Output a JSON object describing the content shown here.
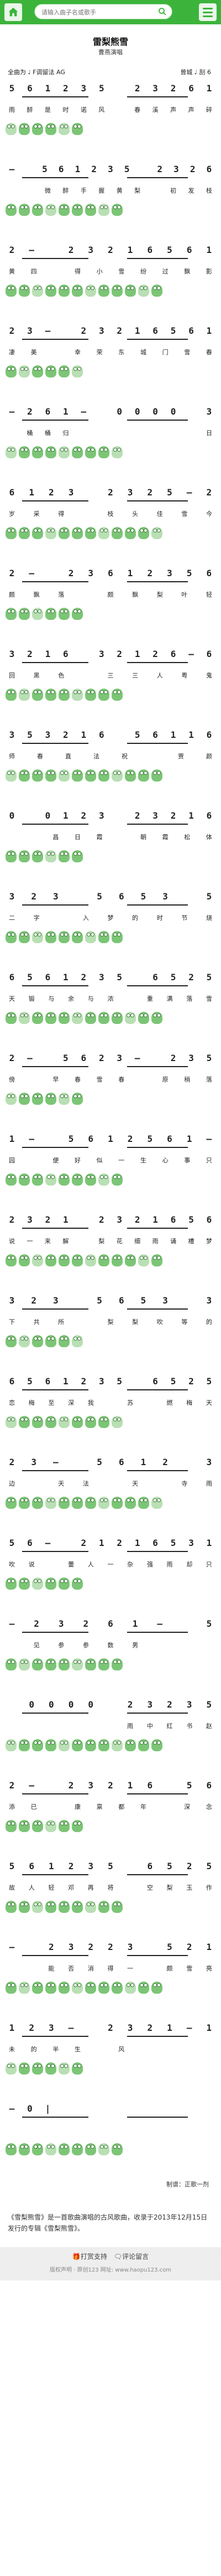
{
  "header": {
    "search_placeholder": "请输入曲子名或歌手",
    "home_icon": "home-icon",
    "menu_icon": "menu-icon"
  },
  "song": {
    "title": "雷梨熊雪",
    "subtitle": "曹燕演唱",
    "meta_left": "全曲为 ♩ F调留法 AG",
    "meta_right": "曾城 ♩ 刮 6"
  },
  "score": [
    {
      "notes": [
        "5",
        "6",
        "1",
        "2",
        "3",
        "5",
        "",
        "2",
        "3",
        "2",
        "6",
        "1"
      ],
      "lyrics": [
        "雨",
        "醉",
        "是",
        "时",
        "诺",
        "风",
        "",
        "春",
        "溪",
        "声",
        "声",
        "碎"
      ]
    },
    {
      "notes": [
        "—",
        "",
        "5",
        "6",
        "1",
        "2",
        "3",
        "5",
        "",
        "2",
        "3",
        "2",
        "6"
      ],
      "lyrics": [
        "",
        "",
        "微",
        "醉",
        "手",
        "握",
        "黄",
        "梨",
        "",
        "初",
        "发",
        "枝"
      ]
    },
    {
      "notes": [
        "2",
        "—",
        "",
        "2",
        "3",
        "2",
        "1",
        "6",
        "5",
        "6",
        "1"
      ],
      "lyrics": [
        "黄",
        "四",
        "",
        "得",
        "小",
        "雪",
        "纷",
        "过",
        "飘",
        "影"
      ]
    },
    {
      "notes": [
        "2",
        "3",
        "—",
        "",
        "2",
        "3",
        "2",
        "1",
        "6",
        "5",
        "6",
        "1"
      ],
      "lyrics": [
        "凄",
        "美",
        "",
        "幸",
        "荣",
        "东",
        "城",
        "门",
        "雪",
        "春"
      ]
    },
    {
      "notes": [
        "—",
        "2",
        "6",
        "1",
        "—",
        "",
        "0",
        "0",
        "0",
        "0",
        "",
        "3"
      ],
      "lyrics": [
        "",
        "桶",
        "桶",
        "归",
        "",
        "",
        "",
        "",
        "",
        "",
        "",
        "日"
      ]
    },
    {
      "notes": [
        "6",
        "1",
        "2",
        "3",
        "",
        "2",
        "3",
        "2",
        "5",
        "—",
        "2"
      ],
      "lyrics": [
        "岁",
        "采",
        "得",
        "",
        "枝",
        "头",
        "佳",
        "雪",
        "今"
      ]
    },
    {
      "notes": [
        "2",
        "—",
        "",
        "2",
        "3",
        "6",
        "1",
        "2",
        "3",
        "5",
        "6"
      ],
      "lyrics": [
        "颇",
        "飘",
        "落",
        "",
        "颇",
        "飘",
        "梨",
        "叶",
        "轻"
      ]
    },
    {
      "notes": [
        "3",
        "2",
        "1",
        "6",
        "",
        "3",
        "2",
        "1",
        "2",
        "6",
        "—",
        "6"
      ],
      "lyrics": [
        "回",
        "黑",
        "色",
        "",
        "三",
        "三",
        "人",
        "粤",
        "鬼"
      ]
    },
    {
      "notes": [
        "3",
        "5",
        "3",
        "2",
        "1",
        "6",
        "",
        "5",
        "6",
        "1",
        "1",
        "6"
      ],
      "lyrics": [
        "师",
        "春",
        "直",
        "法",
        "祝",
        "",
        "贾",
        "颜"
      ]
    },
    {
      "notes": [
        "0",
        "",
        "0",
        "1",
        "2",
        "3",
        "",
        "2",
        "3",
        "2",
        "1",
        "6"
      ],
      "lyrics": [
        "",
        "",
        "昌",
        "日",
        "霞",
        "",
        "朝",
        "霞",
        "松",
        "体"
      ]
    },
    {
      "notes": [
        "3",
        "2",
        "3",
        "",
        "5",
        "6",
        "5",
        "3",
        "",
        "5"
      ],
      "lyrics": [
        "二",
        "字",
        "",
        "入",
        "梦",
        "的",
        "时",
        "节",
        "烧"
      ]
    },
    {
      "notes": [
        "6",
        "5",
        "6",
        "1",
        "2",
        "3",
        "5",
        "",
        "6",
        "5",
        "2",
        "5"
      ],
      "lyrics": [
        "天",
        "锻",
        "与",
        "余",
        "与",
        "浓",
        "",
        "重",
        "满",
        "落",
        "雪"
      ]
    },
    {
      "notes": [
        "2",
        "—",
        "",
        "5",
        "6",
        "2",
        "3",
        "—",
        "",
        "2",
        "3",
        "5"
      ],
      "lyrics": [
        "傍",
        "",
        "早",
        "春",
        "雪",
        "春",
        "",
        "原",
        "稍",
        "落"
      ]
    },
    {
      "notes": [
        "1",
        "—",
        "",
        "5",
        "6",
        "1",
        "2",
        "5",
        "6",
        "1",
        "—"
      ],
      "lyrics": [
        "园",
        "",
        "便",
        "好",
        "似",
        "一",
        "生",
        "心",
        "事",
        "只"
      ]
    },
    {
      "notes": [
        "2",
        "3",
        "2",
        "1",
        "",
        "2",
        "3",
        "2",
        "1",
        "6",
        "5",
        "6"
      ],
      "lyrics": [
        "说",
        "一",
        "来",
        "解",
        "",
        "梨",
        "花",
        "细",
        "雨",
        "诵",
        "槽",
        "梦"
      ]
    },
    {
      "notes": [
        "3",
        "2",
        "3",
        "",
        "5",
        "6",
        "5",
        "3",
        "",
        "3"
      ],
      "lyrics": [
        "下",
        "共",
        "所",
        "",
        "梨",
        "梨",
        "吹",
        "等",
        "的"
      ]
    },
    {
      "notes": [
        "6",
        "5",
        "6",
        "1",
        "2",
        "3",
        "5",
        "",
        "6",
        "5",
        "2",
        "5"
      ],
      "lyrics": [
        "恋",
        "梅",
        "至",
        "深",
        "我",
        "",
        "苏",
        "",
        "燃",
        "梅",
        "天"
      ]
    },
    {
      "notes": [
        "2",
        "3",
        "—",
        "",
        "5",
        "6",
        "1",
        "2",
        "",
        "3"
      ],
      "lyrics": [
        "边",
        "",
        "天",
        "法",
        "",
        "天",
        "",
        "寺",
        "雨"
      ]
    },
    {
      "notes": [
        "5",
        "6",
        "—",
        "",
        "2",
        "1",
        "2",
        "1",
        "6",
        "5",
        "3",
        "1"
      ],
      "lyrics": [
        "吹",
        "说",
        "",
        "蕾",
        "人",
        "一",
        "杂",
        "强",
        "雨",
        "却",
        "只"
      ]
    },
    {
      "notes": [
        "—",
        "2",
        "3",
        "2",
        "6",
        "1",
        "—",
        "",
        "5"
      ],
      "lyrics": [
        "",
        "见",
        "参",
        "参",
        "数",
        "男",
        "",
        "",
        ""
      ]
    },
    {
      "notes": [
        "",
        "0",
        "0",
        "0",
        "0",
        "",
        "2",
        "3",
        "2",
        "3",
        "5"
      ],
      "lyrics": [
        "",
        "",
        "",
        "",
        "",
        "",
        "雨",
        "中",
        "红",
        "书",
        "赵"
      ]
    },
    {
      "notes": [
        "2",
        "—",
        "",
        "2",
        "3",
        "2",
        "1",
        "6",
        "",
        "5",
        "6"
      ],
      "lyrics": [
        "添",
        "已",
        "",
        "康",
        "禀",
        "都",
        "年",
        "",
        "深",
        "念"
      ]
    },
    {
      "notes": [
        "5",
        "6",
        "1",
        "2",
        "3",
        "5",
        "",
        "6",
        "5",
        "2",
        "5"
      ],
      "lyrics": [
        "故",
        "人",
        "轻",
        "邓",
        "再",
        "将",
        "",
        "空",
        "梨",
        "玉",
        "作"
      ]
    },
    {
      "notes": [
        "—",
        "",
        "2",
        "3",
        "2",
        "2",
        "3",
        "",
        "5",
        "2",
        "1"
      ],
      "lyrics": [
        "",
        "",
        "能",
        "否",
        "消",
        "得",
        "一",
        "",
        "颇",
        "雪",
        "亮"
      ]
    },
    {
      "notes": [
        "1",
        "2",
        "3",
        "—",
        "",
        "2",
        "3",
        "2",
        "1",
        "—",
        "1"
      ],
      "lyrics": [
        "未",
        "的",
        "半",
        "生",
        "",
        "风",
        "",
        "",
        "",
        ""
      ]
    },
    {
      "notes": [
        "—",
        "0",
        "|",
        "",
        "",
        "",
        "",
        "",
        "",
        "",
        "",
        ""
      ],
      "lyrics": [
        "",
        "",
        "",
        "",
        "",
        "",
        "",
        "",
        "",
        "",
        "",
        ""
      ]
    }
  ],
  "credit": "制谱：正歌一剂",
  "intro": "《雪梨熊雪》是一首歌曲演唱的古风歌曲，收录于2013年12月15日发行的专辑《雪梨熊雪》。",
  "footer": {
    "actions": "🎁打赏支持　🗨评论留言",
    "copyright": "版权声明 · 原创123 网址: www.haopu123.com"
  }
}
